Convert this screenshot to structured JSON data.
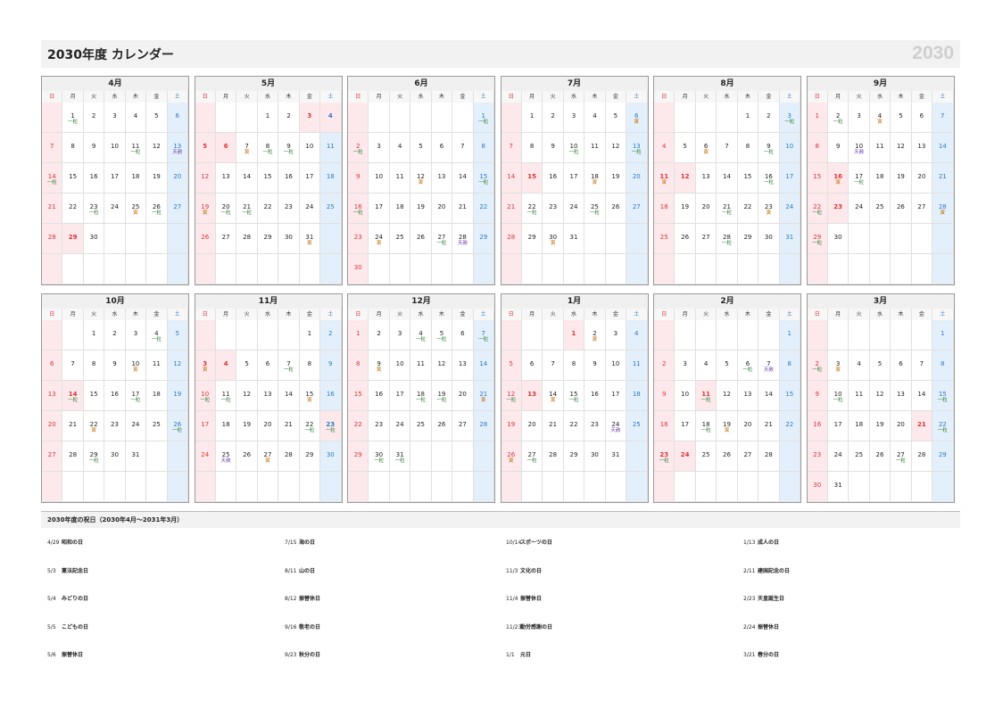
{
  "header": {
    "title": "2030年度 カレンダー",
    "year": "2030"
  },
  "weekdays": [
    "日",
    "月",
    "火",
    "水",
    "木",
    "金",
    "土"
  ],
  "tags": {
    "ichi": "一粒",
    "tora": "寅",
    "ten": "天赦"
  },
  "months": [
    {
      "name": "4月",
      "start": 1,
      "days": 30,
      "hol": [
        29
      ],
      "tags": {
        "1": "ichi",
        "11": "ichi",
        "13": "ten",
        "14": "ichi",
        "23": "ichi",
        "25": "tora",
        "26": "ichi"
      }
    },
    {
      "name": "5月",
      "start": 3,
      "days": 31,
      "hol": [
        3,
        4,
        5,
        6
      ],
      "tags": {
        "7": "tora",
        "8": "ichi",
        "9": "ichi",
        "19": "tora",
        "20": "ichi",
        "21": "ichi",
        "31": "tora"
      }
    },
    {
      "name": "6月",
      "start": 6,
      "days": 30,
      "hol": [],
      "tags": {
        "1": "ichi",
        "2": "ichi",
        "12": "tora",
        "15": "ichi",
        "16": "ichi",
        "24": "tora",
        "27": "ichi",
        "28": "ten"
      }
    },
    {
      "name": "7月",
      "start": 1,
      "days": 31,
      "hol": [
        15
      ],
      "tags": {
        "6": "tora",
        "10": "ichi",
        "13": "ichi",
        "18": "tora",
        "22": "ichi",
        "25": "ichi",
        "30": "tora"
      }
    },
    {
      "name": "8月",
      "start": 4,
      "days": 31,
      "hol": [
        11,
        12
      ],
      "tags": {
        "3": "ichi",
        "6": "tora",
        "9": "ichi",
        "11": "tora",
        "16": "ichi",
        "21": "ichi",
        "23": "tora",
        "28": "ichi"
      }
    },
    {
      "name": "9月",
      "start": 0,
      "days": 30,
      "hol": [
        16,
        23
      ],
      "tags": {
        "2": "ichi",
        "4": "tora",
        "10": "ten",
        "16": "tora",
        "17": "ichi",
        "22": "ichi",
        "28": "tora",
        "29": "ichi"
      }
    },
    {
      "name": "10月",
      "start": 2,
      "days": 31,
      "hol": [
        14
      ],
      "tags": {
        "4": "ichi",
        "10": "tora",
        "14": "ichi",
        "17": "ichi",
        "22": "tora",
        "26": "ichi",
        "29": "ichi"
      }
    },
    {
      "name": "11月",
      "start": 5,
      "days": 30,
      "hol": [
        3,
        4,
        23
      ],
      "tags": {
        "3": "tora",
        "7": "ichi",
        "10": "ichi",
        "11": "ichi",
        "15": "tora",
        "22": "ichi",
        "23": "ichi",
        "25": "ten",
        "27": "tora"
      }
    },
    {
      "name": "12月",
      "start": 0,
      "days": 31,
      "hol": [],
      "tags": {
        "4": "ichi",
        "5": "ichi",
        "7": "ichi",
        "9": "tora",
        "18": "ichi",
        "19": "ichi",
        "21": "tora",
        "30": "ichi",
        "31": "ichi"
      }
    },
    {
      "name": "1月",
      "start": 3,
      "days": 31,
      "hol": [
        1,
        13
      ],
      "tags": {
        "2": "tora",
        "12": "ichi",
        "14": "tora",
        "15": "ichi",
        "24": "ten",
        "26": "tora",
        "27": "ichi"
      }
    },
    {
      "name": "2月",
      "start": 6,
      "days": 28,
      "hol": [
        11,
        23,
        24
      ],
      "tags": {
        "6": "ichi",
        "7": "ten",
        "11": "ichi",
        "18": "ichi",
        "19": "tora",
        "23": "ichi"
      }
    },
    {
      "name": "3月",
      "start": 6,
      "days": 31,
      "hol": [
        21
      ],
      "tags": {
        "2": "ichi",
        "3": "tora",
        "10": "ichi",
        "15": "ichi",
        "22": "ichi",
        "27": "ichi"
      }
    }
  ],
  "holidays_title": "2030年度の祝日（2030年4月～2031年3月）",
  "holidays": [
    {
      "date": "4/29",
      "name": "昭和の日"
    },
    {
      "date": "5/3",
      "name": "憲法記念日"
    },
    {
      "date": "5/4",
      "name": "みどりの日"
    },
    {
      "date": "5/5",
      "name": "こどもの日"
    },
    {
      "date": "5/6",
      "name": "振替休日"
    },
    {
      "date": "7/15",
      "name": "海の日"
    },
    {
      "date": "8/11",
      "name": "山の日"
    },
    {
      "date": "8/12",
      "name": "振替休日"
    },
    {
      "date": "9/16",
      "name": "敬老の日"
    },
    {
      "date": "9/23",
      "name": "秋分の日"
    },
    {
      "date": "10/14",
      "name": "スポーツの日"
    },
    {
      "date": "11/3",
      "name": "文化の日"
    },
    {
      "date": "11/4",
      "name": "振替休日"
    },
    {
      "date": "11/23",
      "name": "勤労感謝の日"
    },
    {
      "date": "1/1",
      "name": "元日"
    },
    {
      "date": "1/13",
      "name": "成人の日"
    },
    {
      "date": "2/11",
      "name": "建国記念の日"
    },
    {
      "date": "2/23",
      "name": "天皇誕生日"
    },
    {
      "date": "2/24",
      "name": "振替休日"
    },
    {
      "date": "3/21",
      "name": "春分の日"
    }
  ]
}
